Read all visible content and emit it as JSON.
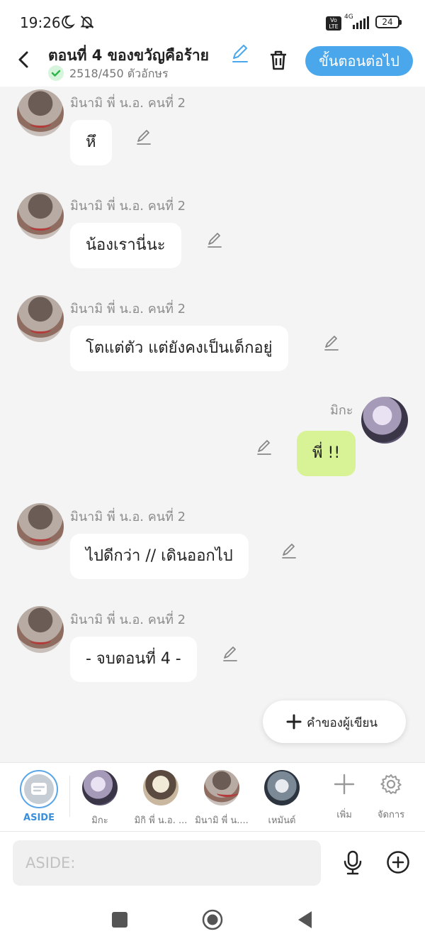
{
  "status_bar": {
    "time": "19:26",
    "network": "4G",
    "battery": "24",
    "volte": "Vo LTE"
  },
  "header": {
    "title": "ตอนที่ 4 ของขวัญคือร้าย",
    "char_count": "2518/450 ตัวอักษร",
    "next_label": "ขั้นตอนต่อไป"
  },
  "messages": [
    {
      "sender": "มินามิ พี่ น.อ. คนที่ 2",
      "text": "หึ",
      "side": "left",
      "avatar": "minami-avatar"
    },
    {
      "sender": "มินามิ พี่ น.อ. คนที่ 2",
      "text": "น้องเรานี่นะ",
      "side": "left",
      "avatar": "minami-avatar"
    },
    {
      "sender": "มินามิ พี่ น.อ. คนที่ 2",
      "text": "โตแต่ตัว แต่ยังคงเป็นเด็กอยู่",
      "side": "left",
      "avatar": "minami-avatar"
    },
    {
      "sender": "มิกะ",
      "text": "พี่ !!",
      "side": "right",
      "avatar": "mika-avatar"
    },
    {
      "sender": "มินามิ พี่ น.อ. คนที่ 2",
      "text": "ไปดีกว่า // เดินออกไป",
      "side": "left",
      "avatar": "minami-avatar"
    },
    {
      "sender": "มินามิ พี่ น.อ. คนที่ 2",
      "text": "- จบตอนที่ 4 -",
      "side": "left",
      "avatar": "minami-avatar"
    }
  ],
  "author_button": {
    "label": "คำของผู้เขียน"
  },
  "character_bar": {
    "aside_label": "ASIDE",
    "characters": [
      {
        "name": "มิกะ"
      },
      {
        "name": "มิกิ พี่ น.อ. ..."
      },
      {
        "name": "มินามิ พี่ น...."
      },
      {
        "name": "เหมันต์"
      }
    ],
    "add_label": "เพิ่ม",
    "manage_label": "จัดการ"
  },
  "input": {
    "placeholder": "ASIDE:",
    "value": ""
  },
  "colors": {
    "accent": "#4aa7ec",
    "my_bubble": "#d8f396",
    "background": "#f4f4f4"
  }
}
